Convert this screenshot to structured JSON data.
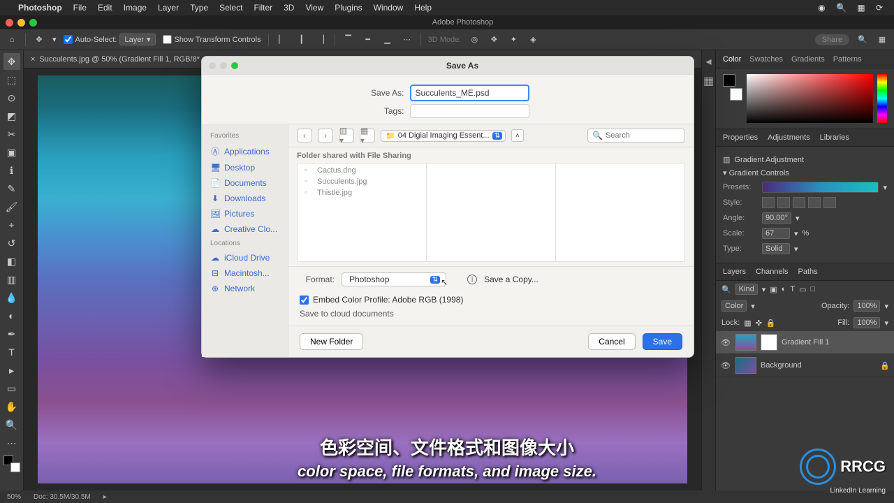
{
  "mac_menu": {
    "app_name": "Photoshop",
    "items": [
      "File",
      "Edit",
      "Image",
      "Layer",
      "Type",
      "Select",
      "Filter",
      "3D",
      "View",
      "Plugins",
      "Window",
      "Help"
    ]
  },
  "window": {
    "title": "Adobe Photoshop"
  },
  "options_bar": {
    "auto_select": "Auto-Select:",
    "auto_select_target": "Layer",
    "show_transform": "Show Transform Controls",
    "three_d_mode": "3D Mode:",
    "share": "Share"
  },
  "doc_tab": {
    "title": "Succulents.jpg @ 50% (Gradient Fill 1, RGB/8*"
  },
  "panels": {
    "color_tabs": [
      "Color",
      "Swatches",
      "Gradients",
      "Patterns"
    ],
    "props_tabs": [
      "Properties",
      "Adjustments",
      "Libraries"
    ],
    "gradient_adjustment": "Gradient Adjustment",
    "section_gradient_controls": "Gradient Controls",
    "presets_label": "Presets:",
    "style_label": "Style:",
    "angle_label": "Angle:",
    "angle_value": "90.00°",
    "scale_label": "Scale:",
    "scale_value": "67",
    "scale_unit": "%",
    "type_label": "Type:",
    "type_value": "Solid",
    "layers_tabs": [
      "Layers",
      "Channels",
      "Paths"
    ],
    "kind_label": "Kind",
    "blend_mode": "Color",
    "opacity_label": "Opacity:",
    "opacity_value": "100%",
    "lock_label": "Lock:",
    "fill_label": "Fill:",
    "fill_value": "100%",
    "layer1": "Gradient Fill 1",
    "layer2": "Background"
  },
  "status": {
    "zoom": "50%",
    "doc_info": "Doc: 30.5M/30.5M"
  },
  "dialog": {
    "title": "Save As",
    "save_as_label": "Save As:",
    "save_as_value": "Succulents_ME.psd",
    "tags_label": "Tags:",
    "sidebar": {
      "favorites": "Favorites",
      "fav_items": [
        "Applications",
        "Desktop",
        "Documents",
        "Downloads",
        "Pictures",
        "Creative Clo..."
      ],
      "locations": "Locations",
      "loc_items": [
        "iCloud Drive",
        "Macintosh...",
        "Network"
      ]
    },
    "path_folder": "04 Digial Imaging Essent...",
    "search_placeholder": "Search",
    "share_note": "Folder shared with File Sharing",
    "files": [
      "Cactus.dng",
      "Succulents.jpg",
      "Thistle.jpg"
    ],
    "format_label": "Format:",
    "format_value": "Photoshop",
    "save_copy": "Save a Copy...",
    "embed_profile": "Embed Color Profile:  Adobe RGB (1998)",
    "save_cloud": "Save to cloud documents",
    "new_folder": "New Folder",
    "cancel": "Cancel",
    "save": "Save"
  },
  "caption": {
    "line1": "色彩空间、文件格式和图像大小",
    "line2": "color space, file formats, and image size."
  },
  "watermark": {
    "text": "RRCG",
    "sub": "LinkedIn Learning"
  }
}
